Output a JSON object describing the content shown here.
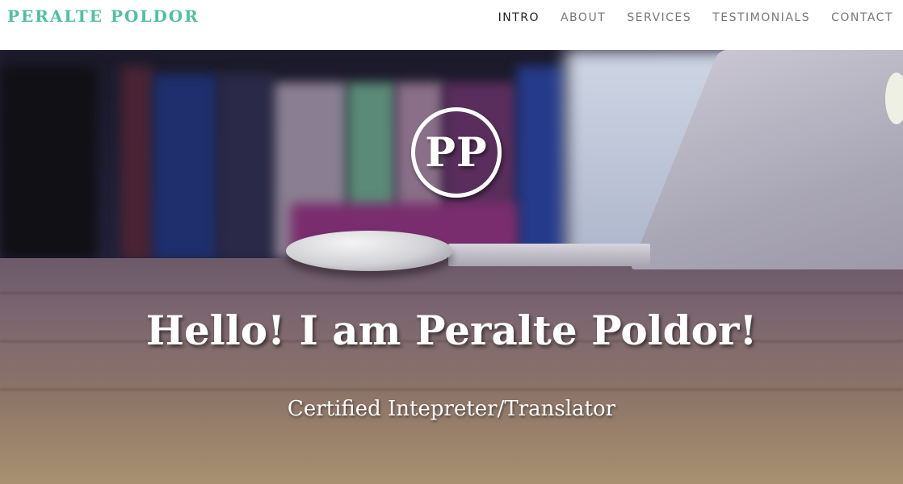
{
  "brand": {
    "name": "PERALTE POLDOR"
  },
  "nav": {
    "items": [
      {
        "label": "INTRO",
        "active": true
      },
      {
        "label": "ABOUT",
        "active": false
      },
      {
        "label": "SERVICES",
        "active": false
      },
      {
        "label": "TESTIMONIALS",
        "active": false
      },
      {
        "label": "CONTACT",
        "active": false
      }
    ]
  },
  "hero": {
    "logo_initials": "PP",
    "headline": "Hello! I am Peralte Poldor!",
    "subheadline": "Certified Intepreter/Translator"
  },
  "colors": {
    "brand": "#4fc1a0",
    "nav_text": "#777777",
    "nav_active": "#222222"
  }
}
